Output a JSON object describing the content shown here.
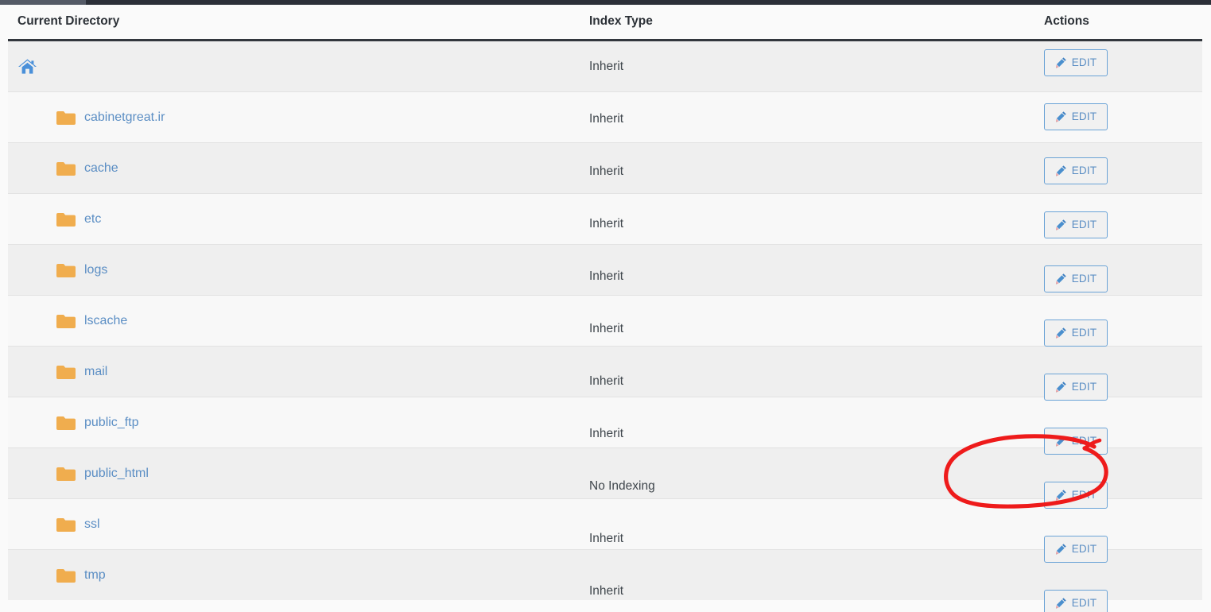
{
  "table": {
    "columns": [
      {
        "key": "directory",
        "label": "Current Directory"
      },
      {
        "key": "index_type",
        "label": "Index Type"
      },
      {
        "key": "actions",
        "label": "Actions"
      }
    ],
    "action_label": "EDIT",
    "rows": [
      {
        "name": "",
        "icon": "home-icon",
        "index_type": "Inherit",
        "action": "EDIT"
      },
      {
        "name": "cabinetgreat.ir",
        "icon": "folder-icon",
        "index_type": "Inherit",
        "action": "EDIT"
      },
      {
        "name": "cache",
        "icon": "folder-icon",
        "index_type": "Inherit",
        "action": "EDIT"
      },
      {
        "name": "etc",
        "icon": "folder-icon",
        "index_type": "Inherit",
        "action": "EDIT"
      },
      {
        "name": "logs",
        "icon": "folder-icon",
        "index_type": "Inherit",
        "action": "EDIT"
      },
      {
        "name": "lscache",
        "icon": "folder-icon",
        "index_type": "Inherit",
        "action": "EDIT"
      },
      {
        "name": "mail",
        "icon": "folder-icon",
        "index_type": "Inherit",
        "action": "EDIT"
      },
      {
        "name": "public_ftp",
        "icon": "folder-icon",
        "index_type": "Inherit",
        "action": "EDIT"
      },
      {
        "name": "public_html",
        "icon": "folder-icon",
        "index_type": "No Indexing",
        "action": "EDIT"
      },
      {
        "name": "ssl",
        "icon": "folder-icon",
        "index_type": "Inherit",
        "action": "EDIT"
      },
      {
        "name": "tmp",
        "icon": "folder-icon",
        "index_type": "Inherit",
        "action": "EDIT"
      }
    ]
  },
  "annotation": {
    "shape": "hand-drawn-ellipse",
    "target": "public_html edit button",
    "color": "#ee1b1b"
  },
  "colors": {
    "link": "#5b8ec4",
    "folder": "#f0ad4e",
    "home": "#4a90d9",
    "button_border": "#6ba3d6",
    "header_text": "#2c3137",
    "row_odd": "#efefef",
    "row_even": "#f8f8f8",
    "annotation_red": "#ee1b1b"
  }
}
